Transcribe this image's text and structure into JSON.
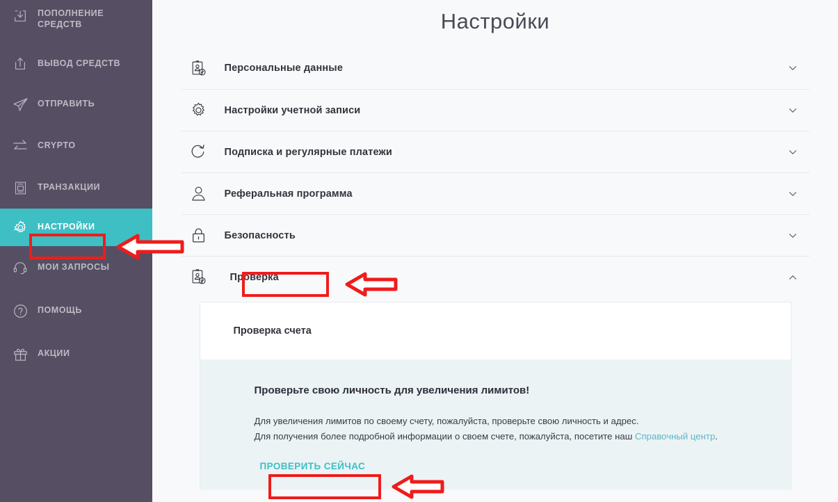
{
  "sidebar": {
    "background_color": "#564f63",
    "active_color": "#3dbfc4",
    "items": [
      {
        "label": "ПОПОЛНЕНИЕ СРЕДСТВ",
        "icon": "download-box-icon",
        "active": false
      },
      {
        "label": "ВЫВОД СРЕДСТВ",
        "icon": "upload-box-icon",
        "active": false
      },
      {
        "label": "ОТПРАВИТЬ",
        "icon": "paper-plane-icon",
        "active": false
      },
      {
        "label": "CRYPTO",
        "icon": "exchange-arrows-icon",
        "active": false
      },
      {
        "label": "ТРАНЗАКЦИИ",
        "icon": "document-list-icon",
        "active": false
      },
      {
        "label": "НАСТРОЙКИ",
        "icon": "gear-icon",
        "active": true
      },
      {
        "label": "МОИ ЗАПРОСЫ",
        "icon": "headset-icon",
        "active": false
      },
      {
        "label": "ПОМОЩЬ",
        "icon": "question-circle-icon",
        "active": false
      },
      {
        "label": "АКЦИИ",
        "icon": "gift-icon",
        "active": false
      }
    ]
  },
  "main": {
    "title": "Настройки",
    "accordion": [
      {
        "label": "Персональные данные",
        "icon": "id-badge-check-icon",
        "expanded": false,
        "chevron": "chevron-down-icon"
      },
      {
        "label": "Настройки учетной записи",
        "icon": "gear-icon",
        "expanded": false,
        "chevron": "chevron-down-icon"
      },
      {
        "label": "Подписка и регулярные платежи",
        "icon": "refresh-icon",
        "expanded": false,
        "chevron": "chevron-down-icon"
      },
      {
        "label": "Реферальная программа",
        "icon": "user-icon",
        "expanded": false,
        "chevron": "chevron-down-icon"
      },
      {
        "label": "Безопасность",
        "icon": "lock-icon",
        "expanded": false,
        "chevron": "chevron-down-icon"
      },
      {
        "label": "Проверка",
        "icon": "id-badge-check-icon",
        "expanded": true,
        "chevron": "chevron-up-icon"
      }
    ],
    "panel": {
      "header_title": "Проверка счета",
      "heading": "Проверьте свою личность для увеличения лимитов!",
      "paragraph_line1": "Для увеличения лимитов по своему счету, пожалуйста, проверьте свою личность и адрес.",
      "paragraph_line2_prefix": "Для получения более подробной информации о своем счете, пожалуйста, посетите наш ",
      "paragraph_link": "Справочный центр",
      "paragraph_line2_suffix": ".",
      "cta_label": "ПРОВЕРИТЬ СЕЙЧАС",
      "cta_color": "#3dbfc4",
      "link_color": "#5fb6c4",
      "body_background": "#ebf3f5"
    }
  },
  "annotations": {
    "color": "#ef1c1c",
    "highlight_boxes": [
      {
        "target": "НАСТРОЙКИ"
      },
      {
        "target": "Проверка"
      },
      {
        "target": "ПРОВЕРИТЬ СЕЙЧАС"
      }
    ],
    "arrows": [
      {
        "target": "НАСТРОЙКИ",
        "direction": "left"
      },
      {
        "target": "Проверка",
        "direction": "left"
      },
      {
        "target": "ПРОВЕРИТЬ СЕЙЧАС",
        "direction": "left"
      }
    ]
  }
}
